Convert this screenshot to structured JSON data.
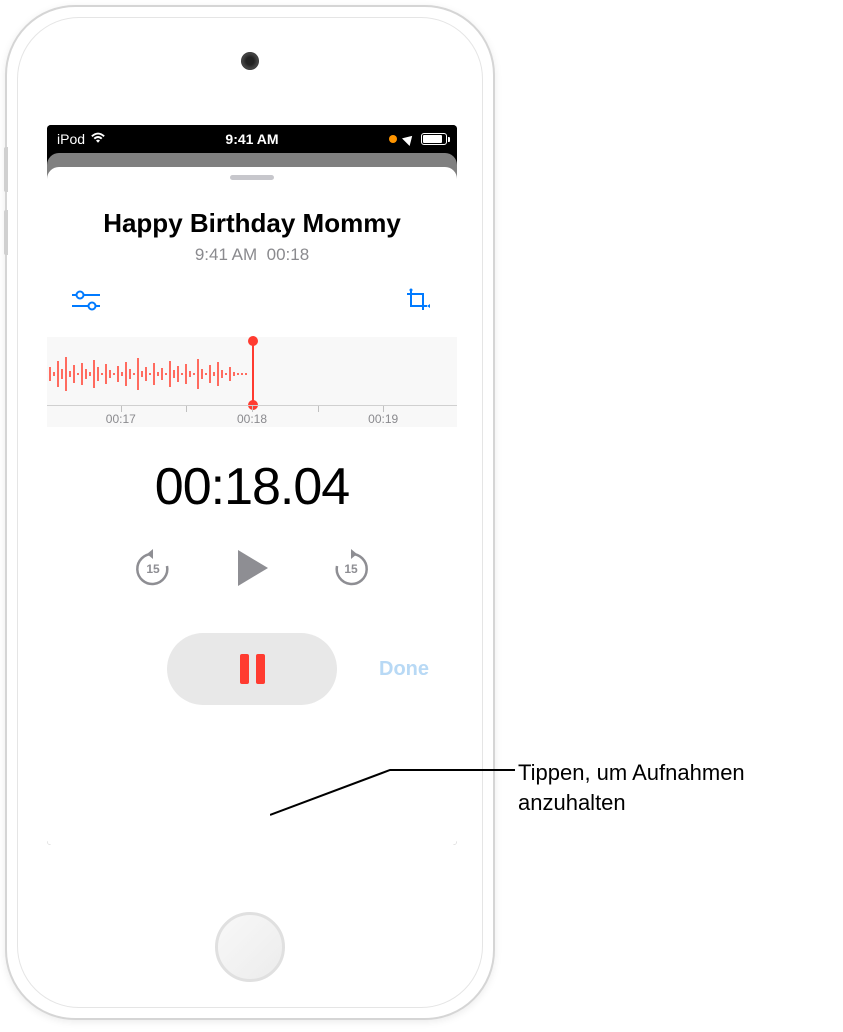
{
  "status_bar": {
    "carrier": "iPod",
    "time": "9:41 AM"
  },
  "recording": {
    "title": "Happy Birthday Mommy",
    "created_time": "9:41 AM",
    "duration": "00:18"
  },
  "timeline": {
    "tick_prev": "00:17",
    "tick_current": "00:18",
    "tick_next": "00:19"
  },
  "timer": {
    "elapsed": "00:18.04"
  },
  "controls": {
    "skip_back_seconds": "15",
    "skip_forward_seconds": "15",
    "done_label": "Done"
  },
  "callout": {
    "line1": "Tippen, um Aufnahmen",
    "line2": "anzuhalten"
  }
}
